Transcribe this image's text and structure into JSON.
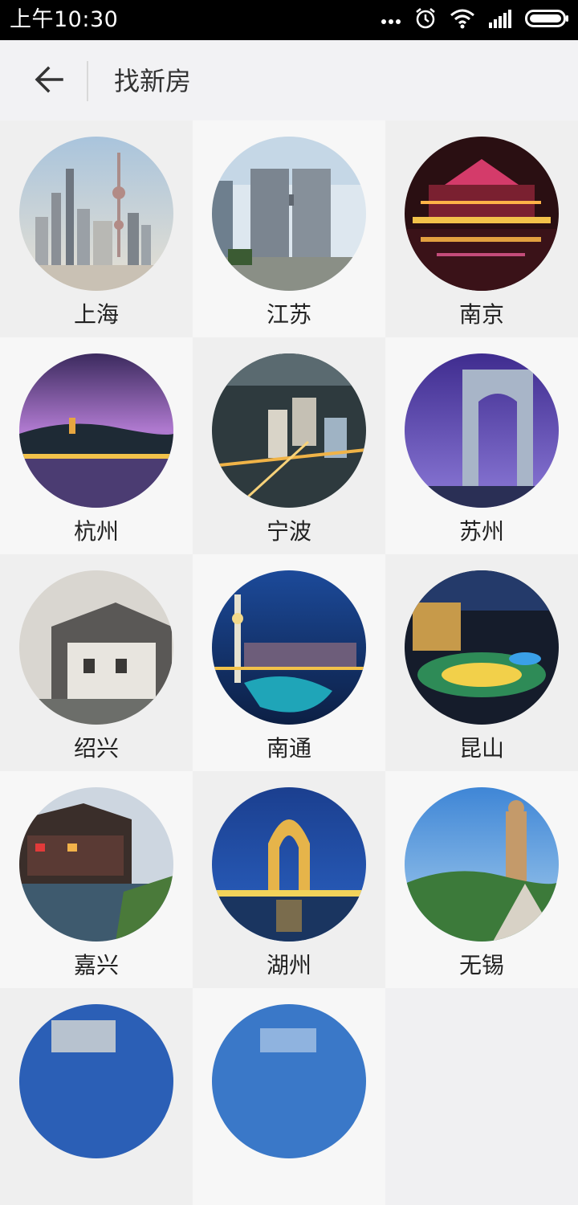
{
  "status_bar": {
    "time": "上午10:30",
    "icons": [
      "more-dots-icon",
      "alarm-icon",
      "wifi-icon",
      "signal-icon",
      "battery-icon"
    ]
  },
  "header": {
    "title": "找新房"
  },
  "cities": [
    {
      "name": "上海"
    },
    {
      "name": "江苏"
    },
    {
      "name": "南京"
    },
    {
      "name": "杭州"
    },
    {
      "name": "宁波"
    },
    {
      "name": "苏州"
    },
    {
      "name": "绍兴"
    },
    {
      "name": "南通"
    },
    {
      "name": "昆山"
    },
    {
      "name": "嘉兴"
    },
    {
      "name": "湖州"
    },
    {
      "name": "无锡"
    },
    {
      "name": ""
    },
    {
      "name": ""
    }
  ]
}
